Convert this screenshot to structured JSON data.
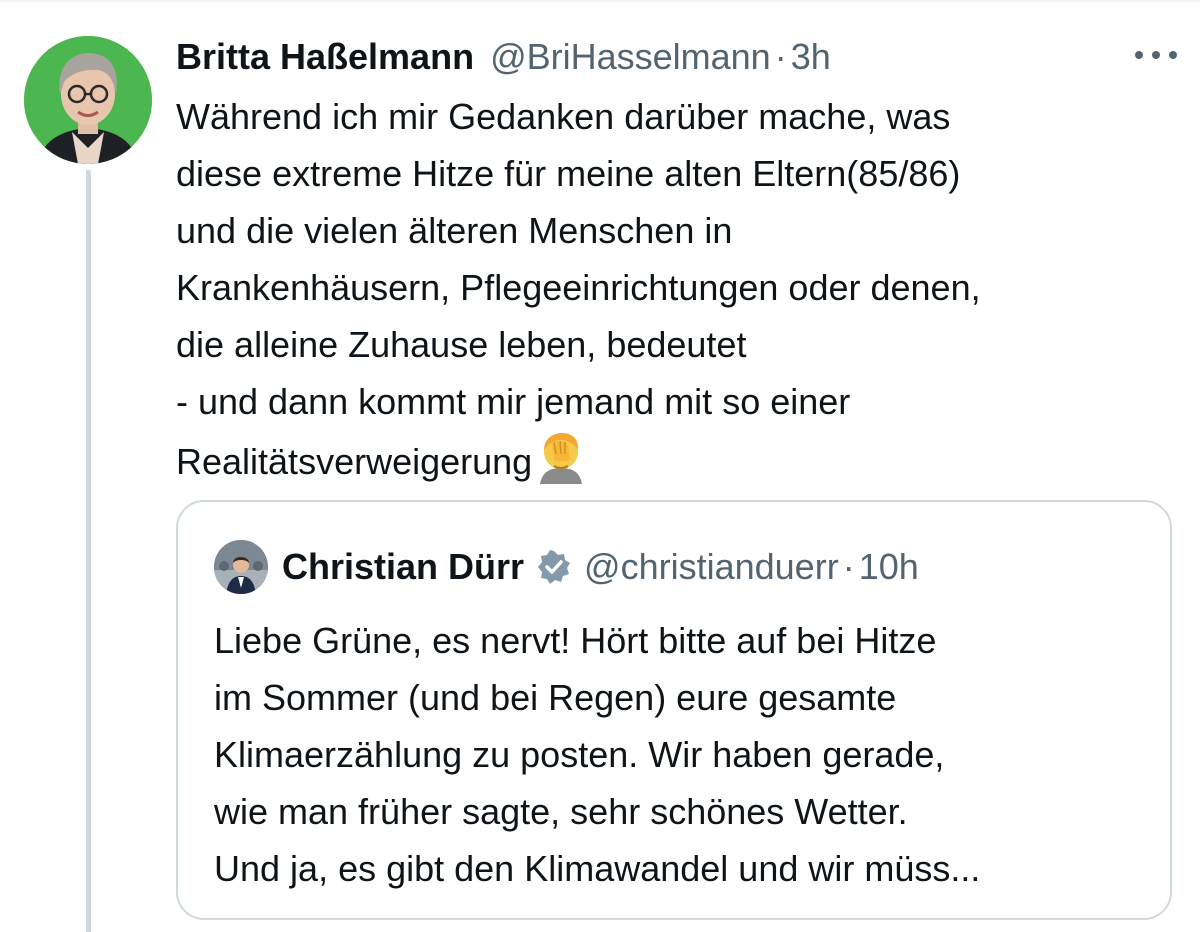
{
  "tweet": {
    "author_name": "Britta Haßelmann",
    "author_handle": "@BriHasselmann",
    "separator": "·",
    "time": "3h",
    "more_icon": "more-horizontal-icon",
    "avatar_bg": "#4cb651",
    "text_lines": [
      "Während ich mir Gedanken darüber mache, was",
      "diese extreme Hitze für meine alten Eltern(85/86)",
      "und die vielen älteren Menschen in",
      "Krankenhäusern, Pflegeeinrichtungen oder denen,",
      "die alleine Zuhause leben, bedeutet",
      "- und dann kommt mir jemand mit so einer",
      "Realitätsverweigerung"
    ],
    "end_emoji": "face-palm-emoji"
  },
  "quote": {
    "author_name": "Christian Dürr",
    "verified_icon": "verified-badge-icon",
    "verified_color": "#829aab",
    "author_handle": "@christianduerr",
    "separator": "·",
    "time": "10h",
    "text_lines": [
      "Liebe Grüne, es nervt! Hört bitte auf bei Hitze",
      "im Sommer (und bei Regen) eure gesamte",
      "Klimaerzählung zu posten. Wir haben gerade,",
      "wie man früher sagte, sehr schönes Wetter.",
      "Und ja, es gibt den Klimawandel und wir müss..."
    ]
  },
  "colors": {
    "text": "#0f1419",
    "secondary_text": "#536471",
    "border": "#cfd9de"
  }
}
